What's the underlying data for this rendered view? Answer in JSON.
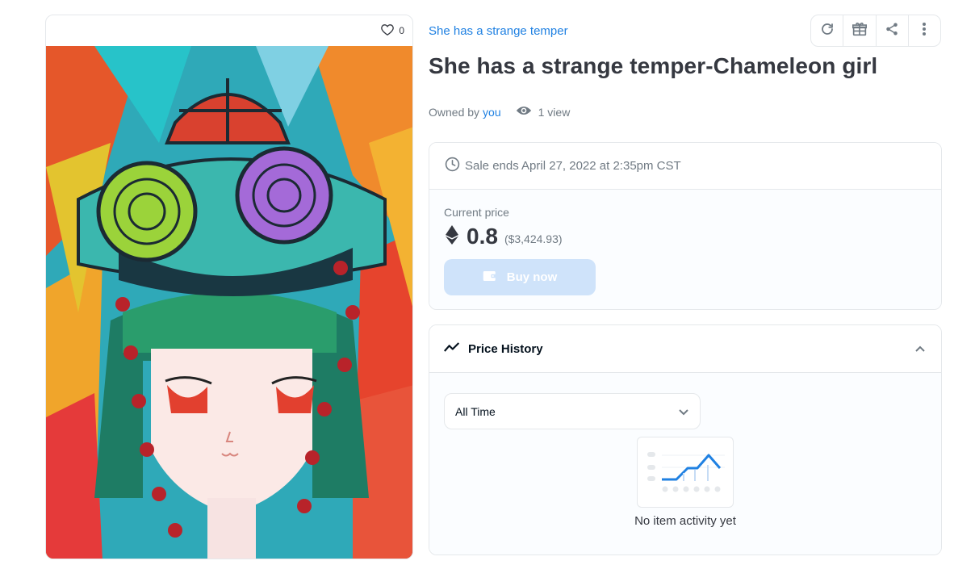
{
  "item": {
    "collection": "She has a strange temper",
    "title": "She has a strange temper-Chameleon girl",
    "favorites": "0",
    "owned_by_label": "Owned by",
    "owner": "you",
    "views": "1 view"
  },
  "actions": {
    "icons": [
      "refresh-icon",
      "gift-icon",
      "share-icon",
      "more-vert-icon"
    ]
  },
  "sale": {
    "ends": "Sale ends April 27, 2022 at 2:35pm CST",
    "price_label": "Current price",
    "price": "0.8",
    "price_usd": "($3,424.93)",
    "currency_icon": "ethereum-icon",
    "buy_label": "Buy now"
  },
  "price_history": {
    "title": "Price History",
    "range": "All Time",
    "empty_message": "No item activity yet"
  },
  "colors": {
    "accent": "#2081e2",
    "buy_disabled": "#cfe3fa",
    "text": "#353840",
    "muted": "#707a83",
    "border": "#e5e8eb"
  }
}
